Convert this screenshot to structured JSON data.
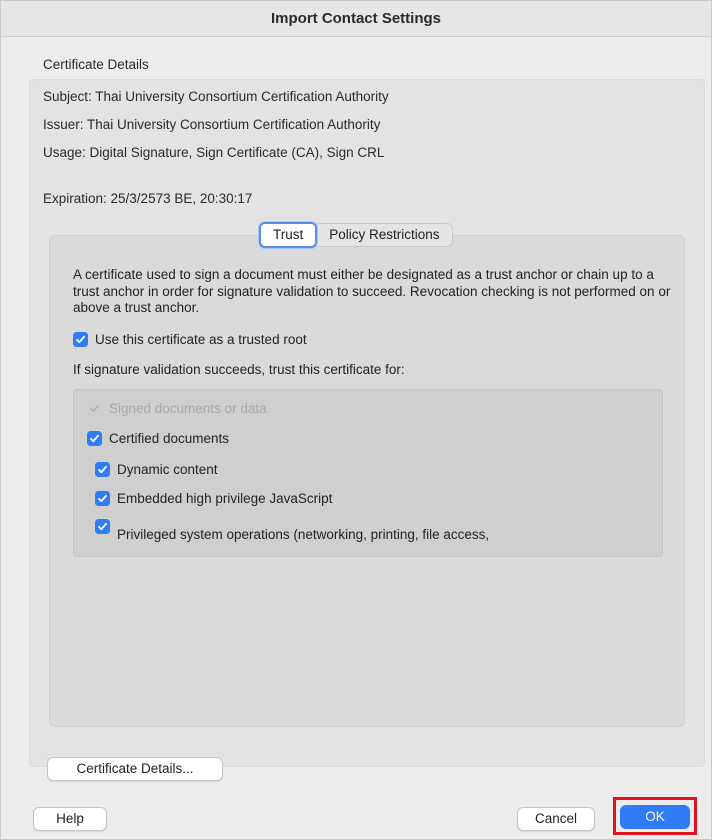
{
  "window": {
    "title": "Import Contact Settings"
  },
  "details": {
    "section_label": "Certificate Details",
    "subject": "Subject:  Thai University Consortium Certification Authority",
    "issuer": "Issuer:  Thai University Consortium Certification Authority",
    "usage": "Usage:  Digital Signature, Sign Certificate (CA), Sign CRL",
    "expiration": "Expiration:  25/3/2573 BE, 20:30:17"
  },
  "tabs": [
    {
      "label": "Trust",
      "active": true
    },
    {
      "label": "Policy Restrictions",
      "active": false
    }
  ],
  "trust": {
    "description": "A certificate used to sign a document must either be designated as a trust anchor or chain up to a trust anchor in order for signature validation to succeed.  Revocation checking is not performed on or above a trust anchor.",
    "use_as_root": {
      "label": "Use this certificate as a trusted root",
      "checked": true
    },
    "trust_for_label": "If signature validation succeeds, trust this certificate for:",
    "options": {
      "signed_docs": {
        "label": "Signed documents or data",
        "checked": true,
        "disabled": true
      },
      "certified_docs": {
        "label": "Certified documents",
        "checked": true
      },
      "dynamic_content": {
        "label": "Dynamic content",
        "checked": true
      },
      "embedded_js": {
        "label": "Embedded high privilege JavaScript",
        "checked": true
      },
      "privileged_ops": {
        "label": "Privileged system operations (networking, printing, file access,",
        "checked": true
      }
    }
  },
  "buttons": {
    "certificate_details": "Certificate Details...",
    "help": "Help",
    "cancel": "Cancel",
    "ok": "OK"
  },
  "colors": {
    "accent": "#2f7cf6",
    "highlight": "#e0141e"
  }
}
